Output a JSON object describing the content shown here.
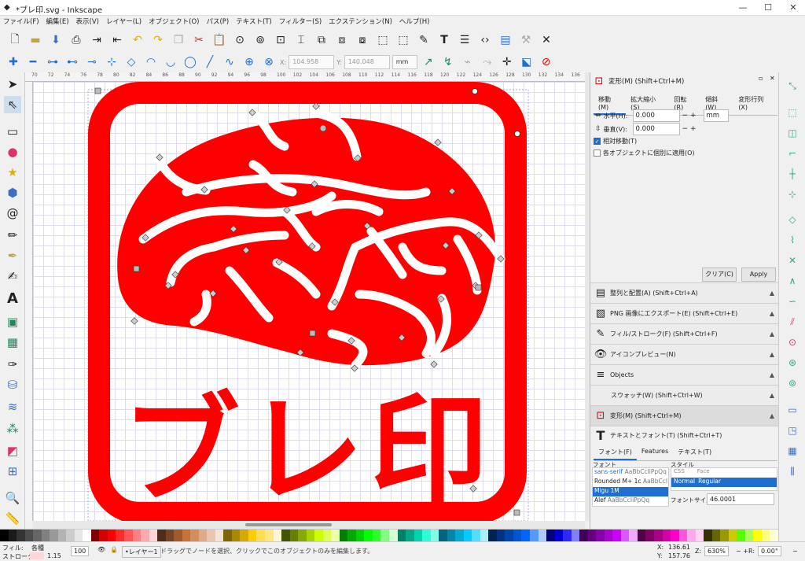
{
  "window": {
    "title": "*ブレ印.svg - Inkscape"
  },
  "menu": [
    "ファイル(F)",
    "編集(E)",
    "表示(V)",
    "レイヤー(L)",
    "オブジェクト(O)",
    "パス(P)",
    "テキスト(T)",
    "フィルター(S)",
    "エクステンション(N)",
    "ヘルプ(H)"
  ],
  "nodebar": {
    "x_label": "X:",
    "x_value": "104.958",
    "y_label": "Y:",
    "y_value": "140.048",
    "unit": "mm"
  },
  "ruler_ticks": [
    "70",
    "72",
    "74",
    "76",
    "78",
    "80",
    "82",
    "84",
    "86",
    "88",
    "90",
    "92",
    "94",
    "96",
    "98",
    "100",
    "102",
    "104",
    "106",
    "108",
    "110",
    "112",
    "114",
    "116",
    "118",
    "120",
    "122",
    "124",
    "126",
    "128",
    "130",
    "132",
    "134",
    "136"
  ],
  "canvas": {
    "stamp_text": "ブレ印",
    "stamp_color": "#ff0000"
  },
  "transform": {
    "title": "変形(M) (Shift+Ctrl+M)",
    "tabs": [
      "移動(M)",
      "拡大縮小(S)",
      "回転(R)",
      "傾斜(W)",
      "変形行列(X)"
    ],
    "h_label": "水平(H):",
    "h_value": "0.000",
    "v_label": "垂直(V):",
    "v_value": "0.000",
    "unit": "mm",
    "relative_label": "相対移動(T)",
    "each_label": "各オブジェクトに個別に適用(O)",
    "clear": "クリア(C)",
    "apply": "Apply"
  },
  "docks": [
    "整列と配置(A) (Shift+Ctrl+A)",
    "PNG 画像にエクスポート(E) (Shift+Ctrl+E)",
    "フィル/ストローク(F) (Shift+Ctrl+F)",
    "アイコンプレビュー(N)",
    "Objects",
    "スウォッチ(W) (Shift+Ctrl+W)",
    "変形(M) (Shift+Ctrl+M)"
  ],
  "textfont": {
    "title": "テキストとフォント(T) (Shift+Ctrl+T)",
    "tabs": [
      "フォント(F)",
      "Features",
      "テキスト(T)"
    ],
    "font_label": "フォント",
    "style_label": "スタイル",
    "fonts": [
      {
        "name": "sans-serif",
        "sample": "AaBbCcIiPpQq"
      },
      {
        "name": "Rounded M+ 1c",
        "sample": "AaBbCcI"
      },
      {
        "name": "Migu 1M",
        "sample": ""
      },
      {
        "name": "Alef",
        "sample": "AaBbCcIiPpQq"
      }
    ],
    "css_label": "CSS",
    "face_label": "Face",
    "style_css": "Normal",
    "style_face": "Regular",
    "size_label": "フォントサイズ",
    "size_value": "46.0001"
  },
  "status": {
    "fill_label": "フィル:",
    "fill_value": "各種",
    "stroke_label": "ストローク:",
    "stroke_value": "1.15",
    "opacity": "100",
    "layer": "•レイヤー1",
    "message": "ドラッグでノードを選択、クリックでこのオブジェクトのみを編集します。",
    "x_label": "X:",
    "x": "136.61",
    "y_label": "Y:",
    "y": "157.76",
    "z_label": "Z:",
    "zoom": "630%",
    "r_label": "R:",
    "rotation": "0.00°"
  },
  "palette": [
    "#000000",
    "#1a1a1a",
    "#333333",
    "#4d4d4d",
    "#666666",
    "#808080",
    "#999999",
    "#b3b3b3",
    "#cccccc",
    "#e6e6e6",
    "#ffffff",
    "#800000",
    "#d40000",
    "#ff0000",
    "#ff2a2a",
    "#ff5555",
    "#ff8080",
    "#ffaaaa",
    "#ffd5d5",
    "#502d16",
    "#784421",
    "#a05a2c",
    "#c87137",
    "#d38d5f",
    "#deaa87",
    "#e9c6af",
    "#f4e3d7",
    "#806600",
    "#aa8800",
    "#d4aa00",
    "#ffcc00",
    "#ffdd55",
    "#ffe680",
    "#fff6d5",
    "#445500",
    "#668000",
    "#88aa00",
    "#aad400",
    "#ccff00",
    "#ddff55",
    "#eeffaa",
    "#008000",
    "#00aa00",
    "#00d400",
    "#00ff00",
    "#2aff2a",
    "#80ff80",
    "#d5ffd5",
    "#008066",
    "#00aa88",
    "#00d4aa",
    "#2affd5",
    "#80ffe6",
    "#006680",
    "#0088aa",
    "#00aad4",
    "#00ccff",
    "#55ddff",
    "#aaeeff",
    "#002255",
    "#003380",
    "#0044aa",
    "#0055d4",
    "#0066ff",
    "#5599ff",
    "#aaccff",
    "#000080",
    "#0000d4",
    "#2a2aff",
    "#8080ff",
    "#440055",
    "#660080",
    "#8800aa",
    "#aa00d4",
    "#cc00ff",
    "#dd55ff",
    "#eeaaff",
    "#550044",
    "#800066",
    "#aa0088",
    "#d400aa",
    "#ff00cc",
    "#ff55dd",
    "#ffaaee",
    "#ffd5f6",
    "#333300",
    "#666600",
    "#999900",
    "#cccc00",
    "#55ff00",
    "#aaff55",
    "#ffff00",
    "#ffff80",
    "#ffffd5"
  ]
}
